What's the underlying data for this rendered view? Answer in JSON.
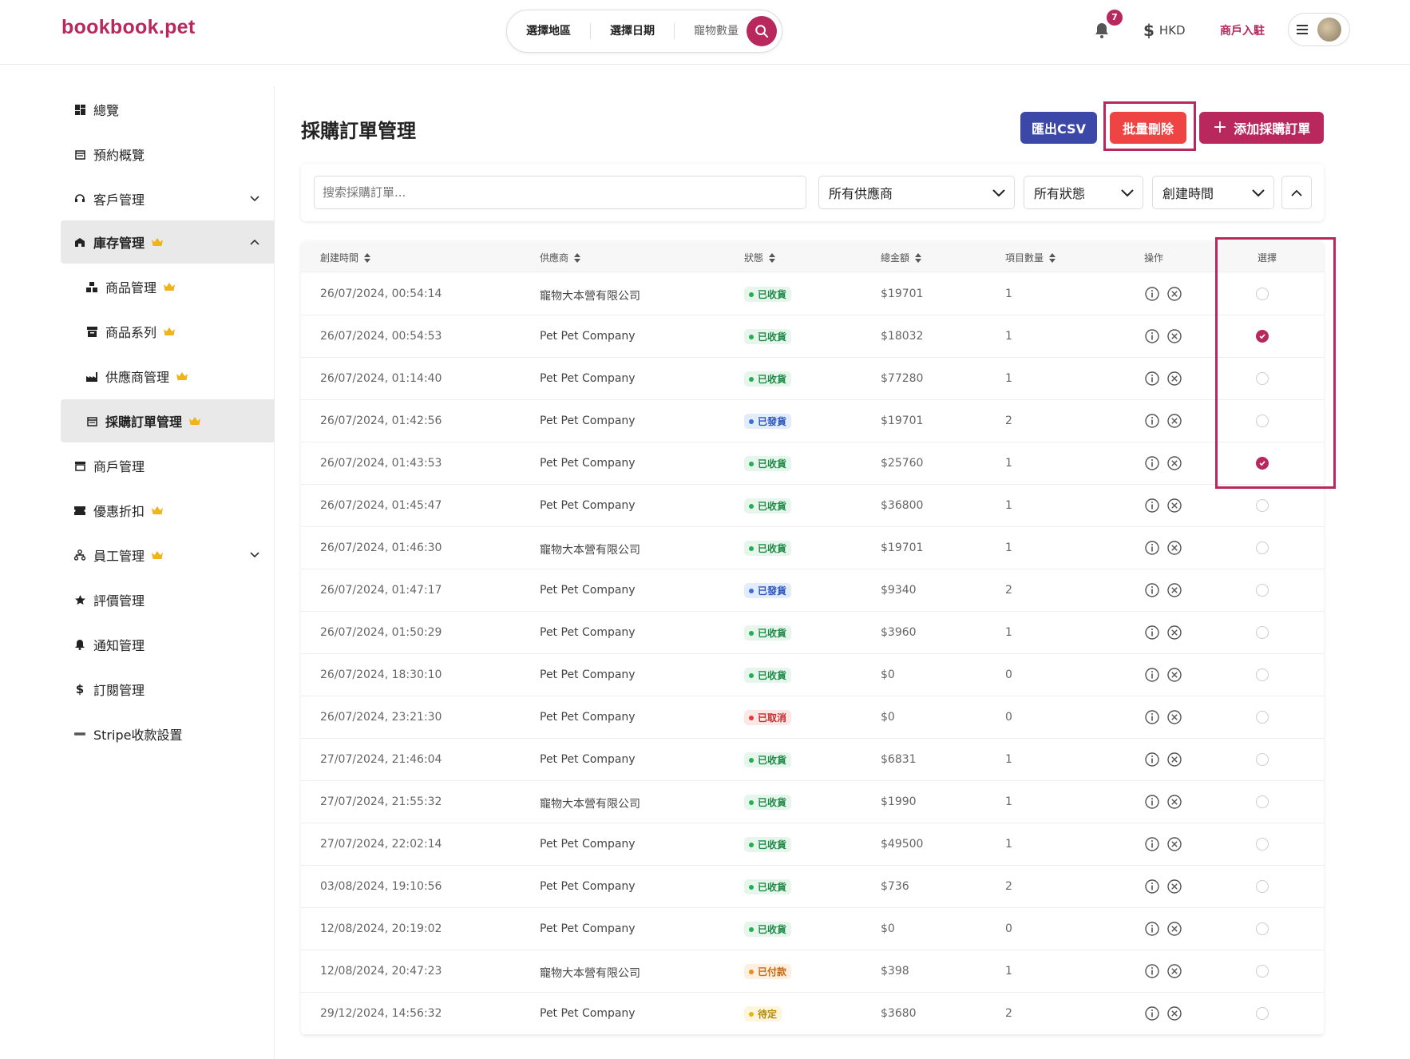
{
  "header": {
    "logo": "bookbook.pet",
    "search": {
      "region": "選擇地區",
      "date": "選擇日期",
      "pets": "寵物數量"
    },
    "notification_count": "7",
    "currency": "HKD",
    "merchant_link": "商戶入駐"
  },
  "sidebar": {
    "items": [
      {
        "label": "總覽"
      },
      {
        "label": "預約概覽"
      },
      {
        "label": "客戶管理"
      },
      {
        "label": "庫存管理"
      },
      {
        "label": "商品管理"
      },
      {
        "label": "商品系列"
      },
      {
        "label": "供應商管理"
      },
      {
        "label": "採購訂單管理"
      },
      {
        "label": "商戶管理"
      },
      {
        "label": "優惠折扣"
      },
      {
        "label": "員工管理"
      },
      {
        "label": "評價管理"
      },
      {
        "label": "通知管理"
      },
      {
        "label": "訂閱管理"
      },
      {
        "label": "Stripe收款設置"
      }
    ]
  },
  "page": {
    "title": "採購訂單管理",
    "export_csv": "匯出CSV",
    "bulk_delete": "批量刪除",
    "add_order": "添加採購訂單"
  },
  "filters": {
    "search_placeholder": "搜索採購訂單...",
    "supplier": "所有供應商",
    "status": "所有狀態",
    "sort": "創建時間"
  },
  "table": {
    "headers": {
      "created": "創建時間",
      "supplier": "供應商",
      "status": "狀態",
      "total": "總金額",
      "items": "項目數量",
      "actions": "操作",
      "select": "選擇"
    },
    "rows": [
      {
        "created": "26/07/2024, 00:54:14",
        "supplier": "寵物大本營有限公司",
        "status": "已收貨",
        "total": "$19701",
        "items": "1",
        "selected": false
      },
      {
        "created": "26/07/2024, 00:54:53",
        "supplier": "Pet Pet Company",
        "status": "已收貨",
        "total": "$18032",
        "items": "1",
        "selected": true
      },
      {
        "created": "26/07/2024, 01:14:40",
        "supplier": "Pet Pet Company",
        "status": "已收貨",
        "total": "$77280",
        "items": "1",
        "selected": false
      },
      {
        "created": "26/07/2024, 01:42:56",
        "supplier": "Pet Pet Company",
        "status": "已發貨",
        "total": "$19701",
        "items": "2",
        "selected": false
      },
      {
        "created": "26/07/2024, 01:43:53",
        "supplier": "Pet Pet Company",
        "status": "已收貨",
        "total": "$25760",
        "items": "1",
        "selected": true
      },
      {
        "created": "26/07/2024, 01:45:47",
        "supplier": "Pet Pet Company",
        "status": "已收貨",
        "total": "$36800",
        "items": "1",
        "selected": false
      },
      {
        "created": "26/07/2024, 01:46:30",
        "supplier": "寵物大本營有限公司",
        "status": "已收貨",
        "total": "$19701",
        "items": "1",
        "selected": false
      },
      {
        "created": "26/07/2024, 01:47:17",
        "supplier": "Pet Pet Company",
        "status": "已發貨",
        "total": "$9340",
        "items": "2",
        "selected": false
      },
      {
        "created": "26/07/2024, 01:50:29",
        "supplier": "Pet Pet Company",
        "status": "已收貨",
        "total": "$3960",
        "items": "1",
        "selected": false
      },
      {
        "created": "26/07/2024, 18:30:10",
        "supplier": "Pet Pet Company",
        "status": "已收貨",
        "total": "$0",
        "items": "0",
        "selected": false
      },
      {
        "created": "26/07/2024, 23:21:30",
        "supplier": "Pet Pet Company",
        "status": "已取消",
        "total": "$0",
        "items": "0",
        "selected": false
      },
      {
        "created": "27/07/2024, 21:46:04",
        "supplier": "Pet Pet Company",
        "status": "已收貨",
        "total": "$6831",
        "items": "1",
        "selected": false
      },
      {
        "created": "27/07/2024, 21:55:32",
        "supplier": "寵物大本營有限公司",
        "status": "已收貨",
        "total": "$1990",
        "items": "1",
        "selected": false
      },
      {
        "created": "27/07/2024, 22:02:14",
        "supplier": "Pet Pet Company",
        "status": "已收貨",
        "total": "$49500",
        "items": "1",
        "selected": false
      },
      {
        "created": "03/08/2024, 19:10:56",
        "supplier": "Pet Pet Company",
        "status": "已收貨",
        "total": "$736",
        "items": "2",
        "selected": false
      },
      {
        "created": "12/08/2024, 20:19:02",
        "supplier": "Pet Pet Company",
        "status": "已收貨",
        "total": "$0",
        "items": "0",
        "selected": false
      },
      {
        "created": "12/08/2024, 20:47:23",
        "supplier": "寵物大本營有限公司",
        "status": "已付款",
        "total": "$398",
        "items": "1",
        "selected": false
      },
      {
        "created": "29/12/2024, 14:56:32",
        "supplier": "Pet Pet Company",
        "status": "待定",
        "total": "$3680",
        "items": "2",
        "selected": false
      }
    ]
  },
  "colors": {
    "brand": "#b8285c",
    "csv": "#3c48a8",
    "delete": "#ee4444"
  }
}
